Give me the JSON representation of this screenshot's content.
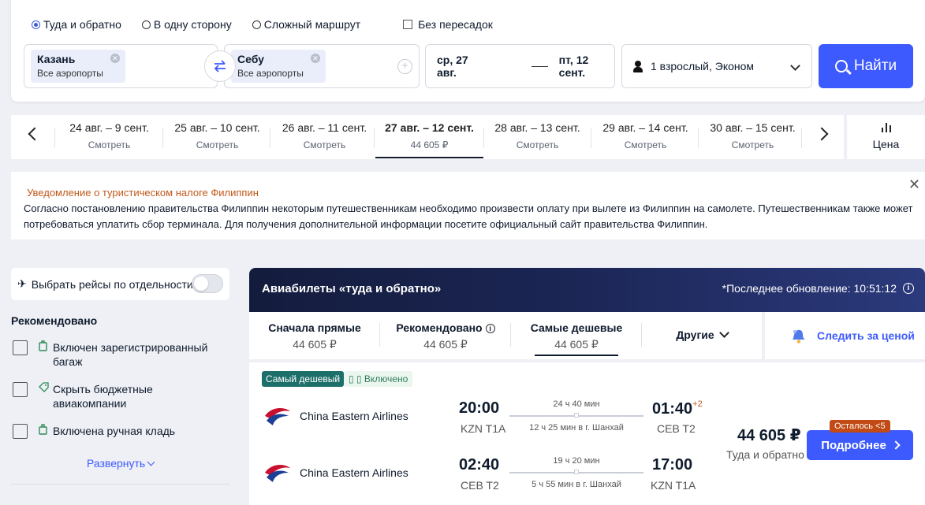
{
  "search": {
    "trip_types": [
      "Туда и обратно",
      "В одну сторону",
      "Сложный маршрут"
    ],
    "selected_trip_type": "Туда и обратно",
    "nonstop_label": "Без пересадок",
    "origin": {
      "city": "Казань",
      "airports": "Все аэропорты"
    },
    "destination": {
      "city": "Себу",
      "airports": "Все аэропорты"
    },
    "depart_date": "ср, 27 авг.",
    "return_date": "пт, 12 сент.",
    "passengers": "1 взрослый, Эконом",
    "find_label": "Найти"
  },
  "date_strip": {
    "items": [
      {
        "range": "24 авг. – 9 сент.",
        "price": "Смотреть"
      },
      {
        "range": "25 авг. – 10 сент.",
        "price": "Смотреть"
      },
      {
        "range": "26 авг. – 11 сент.",
        "price": "Смотреть"
      },
      {
        "range": "27 авг. – 12 сент.",
        "price": "44 605 ₽",
        "active": true
      },
      {
        "range": "28 авг. – 13 сент.",
        "price": "Смотреть"
      },
      {
        "range": "29 авг. – 14 сент.",
        "price": "Смотреть"
      },
      {
        "range": "30 авг. – 15 сент.",
        "price": "Смотреть"
      }
    ],
    "price_sort_label": "Цена"
  },
  "notice": {
    "title": "Уведомление о туристическом налоге Филиппин",
    "body": "Согласно постановлению правительства Филиппин некоторым путешественникам необходимо произвести оплату при вылете из Филиппин на самолете. Путешественникам также может потребоваться уплатить сбор терминала. Для получения дополнительной информации посетите официальный сайт правительства Филиппин."
  },
  "filters": {
    "separate_flights_label": "Выбрать рейсы по отдельности",
    "section_title": "Рекомендовано",
    "items": [
      {
        "label": "Включен зарегистрированный багаж",
        "icon": "luggage-icon"
      },
      {
        "label": "Скрыть бюджетные авиакомпании",
        "icon": "tag-icon"
      },
      {
        "label": "Включена ручная кладь",
        "icon": "bag-icon"
      }
    ],
    "expand_label": "Развернуть"
  },
  "results": {
    "banner_title": "Авиабилеты «туда и обратно»",
    "last_update": "*Последнее обновление: 10:51:12",
    "sort_tabs": [
      {
        "label": "Сначала прямые",
        "value": "44 605 ₽"
      },
      {
        "label": "Рекомендовано",
        "value": "44 605 ₽"
      },
      {
        "label": "Самые дешевые",
        "value": "44 605 ₽",
        "active": true
      }
    ],
    "other_label": "Другие",
    "track_price_label": "Следить за ценой"
  },
  "ticket": {
    "badge_cheapest": "Самый дешевый",
    "badge_included": "Включено",
    "price": "44 605 ₽",
    "price_note": "Туда и обратно",
    "seats_left": "Осталось <5",
    "details_label": "Подробнее",
    "legs": [
      {
        "airline": "China Eastern Airlines",
        "dep_time": "20:00",
        "dep_airport": "KZN T1A",
        "arr_time": "01:40",
        "arr_plus": "+2",
        "arr_airport": "CEB T2",
        "duration": "24 ч 40 мин",
        "layover": "12 ч 25 мин в г. Шанхай"
      },
      {
        "airline": "China Eastern Airlines",
        "dep_time": "02:40",
        "dep_airport": "CEB T2",
        "arr_time": "17:00",
        "arr_plus": "",
        "arr_airport": "KZN T1A",
        "duration": "19 ч 20 мин",
        "layover": "5 ч 55 мин в г. Шанхай"
      }
    ]
  },
  "colors": {
    "accent": "#3d5afe",
    "cheapest_badge": "#1d6f6a",
    "notice_title": "#c0581a"
  }
}
